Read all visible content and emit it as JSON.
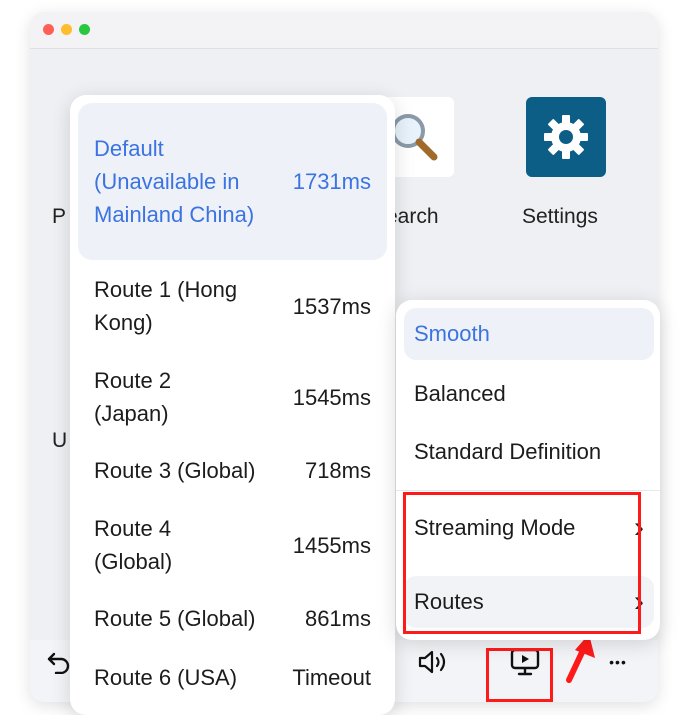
{
  "background": {
    "left_partial_label_1": "P",
    "left_partial_label_2": "U",
    "search_label": "earch",
    "settings_label": "Settings"
  },
  "routes_menu": {
    "items": [
      {
        "name": "Default (Unavailable in Mainland China)",
        "latency": "1731ms",
        "selected": true
      },
      {
        "name": "Route 1 (Hong Kong)",
        "latency": "1537ms",
        "selected": false
      },
      {
        "name": "Route 2 (Japan)",
        "latency": "1545ms",
        "selected": false
      },
      {
        "name": "Route 3 (Global)",
        "latency": "718ms",
        "selected": false
      },
      {
        "name": "Route 4 (Global)",
        "latency": "1455ms",
        "selected": false
      },
      {
        "name": "Route 5 (Global)",
        "latency": "861ms",
        "selected": false
      },
      {
        "name": "Route 6 (USA)",
        "latency": "Timeout",
        "selected": false
      }
    ]
  },
  "stream_menu": {
    "quality_options": [
      {
        "label": "Smooth",
        "selected": true
      },
      {
        "label": "Balanced",
        "selected": false
      },
      {
        "label": "Standard Definition",
        "selected": false
      }
    ],
    "streaming_mode_label": "Streaming Mode",
    "routes_label": "Routes",
    "chevron": "›"
  },
  "toolbar": {
    "icons": [
      "back-icon",
      "volume-icon",
      "display-icon",
      "more-icon"
    ],
    "more_glyph": "•••"
  },
  "colors": {
    "accent": "#3b73e0",
    "annotation": "#ff1a1a",
    "settings_tile": "#0d5e86"
  }
}
